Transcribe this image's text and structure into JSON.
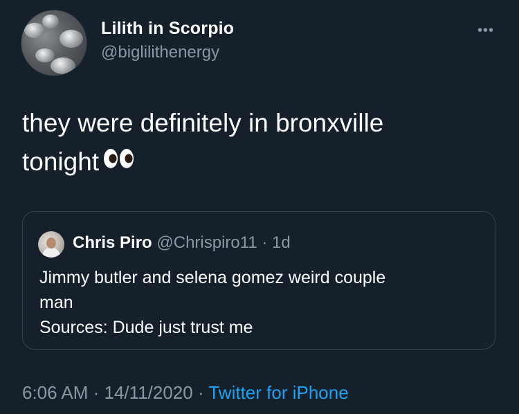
{
  "tweet": {
    "author": {
      "name": "Lilith in Scorpio",
      "handle": "@biglilithenergy"
    },
    "text_line1": "they were definitely in bronxville",
    "text_line2": "tonight",
    "emoji": "eyes-emoji",
    "more_label": "•••",
    "quoted": {
      "name": "Chris Piro",
      "handle": "@Chrispiro11",
      "separator": "·",
      "time": "1d",
      "lines": [
        "Jimmy butler and selena gomez weird couple",
        "man",
        "Sources: Dude just trust me"
      ]
    },
    "meta": {
      "time": "6:06 AM",
      "sep1": " · ",
      "date": "14/11/2020",
      "sep2": " · ",
      "source": "Twitter for iPhone"
    }
  },
  "colors": {
    "background": "#15202b",
    "secondary_text": "#8899a6",
    "link": "#1da1f2",
    "border": "#38444d"
  }
}
